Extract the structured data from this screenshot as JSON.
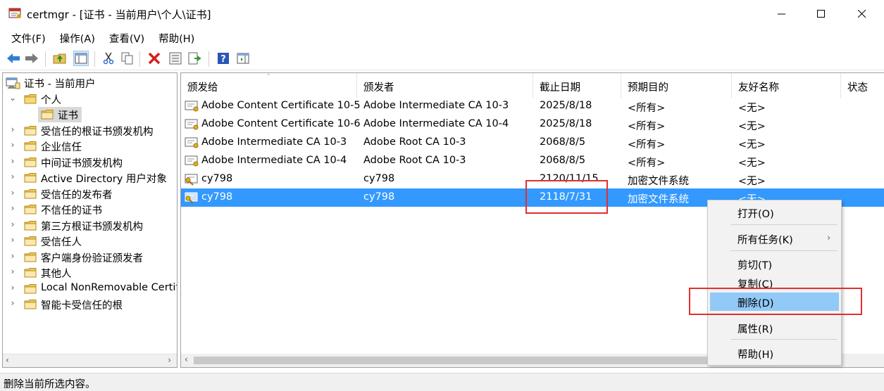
{
  "window": {
    "title": "certmgr - [证书 - 当前用户\\个人\\证书]"
  },
  "menu": [
    "文件(F)",
    "操作(A)",
    "查看(V)",
    "帮助(H)"
  ],
  "toolbar": {
    "buttons": [
      "back-icon",
      "forward-icon",
      "up-folder-icon",
      "show-hide-tree-icon",
      "cut-icon",
      "copy-icon",
      "delete-icon",
      "properties-icon",
      "export-icon",
      "help-icon",
      "show-action-pane-icon"
    ]
  },
  "tree": {
    "root": "证书 - 当前用户",
    "personal": "个人",
    "certificates": "证书",
    "items": [
      "受信任的根证书颁发机构",
      "企业信任",
      "中间证书颁发机构",
      "Active Directory 用户对象",
      "受信任的发布者",
      "不信任的证书",
      "第三方根证书颁发机构",
      "受信任人",
      "客户端身份验证颁发者",
      "其他人",
      "Local NonRemovable Certifi",
      "智能卡受信任的根"
    ]
  },
  "list": {
    "columns": [
      "颁发给",
      "颁发者",
      "截止日期",
      "预期目的",
      "友好名称",
      "状态"
    ],
    "rows": [
      {
        "issued_to": "Adobe Content Certificate 10-5",
        "issued_by": "Adobe Intermediate CA 10-3",
        "expiry": "2025/8/18",
        "purpose": "<所有>",
        "friendly": "<无>"
      },
      {
        "issued_to": "Adobe Content Certificate 10-6",
        "issued_by": "Adobe Intermediate CA 10-4",
        "expiry": "2025/8/18",
        "purpose": "<所有>",
        "friendly": "<无>"
      },
      {
        "issued_to": "Adobe Intermediate CA 10-3",
        "issued_by": "Adobe Root CA 10-3",
        "expiry": "2068/8/5",
        "purpose": "<所有>",
        "friendly": "<无>"
      },
      {
        "issued_to": "Adobe Intermediate CA 10-4",
        "issued_by": "Adobe Root CA 10-3",
        "expiry": "2068/8/5",
        "purpose": "<所有>",
        "friendly": "<无>"
      },
      {
        "issued_to": "cy798",
        "issued_by": "cy798",
        "expiry": "2120/11/15",
        "purpose": "加密文件系统",
        "friendly": "<无>"
      },
      {
        "issued_to": "cy798",
        "issued_by": "cy798",
        "expiry": "2118/7/31",
        "purpose": "加密文件系统",
        "friendly": "<无>"
      }
    ]
  },
  "context_menu": {
    "open": "打开(O)",
    "all_tasks": "所有任务(K)",
    "cut": "剪切(T)",
    "copy": "复制(C)",
    "delete": "删除(D)",
    "properties": "属性(R)",
    "help": "帮助(H)"
  },
  "status": "删除当前所选内容。",
  "colors": {
    "selection": "#3399ff",
    "menu_hover": "#91c9f7",
    "annotation": "#e03030"
  }
}
